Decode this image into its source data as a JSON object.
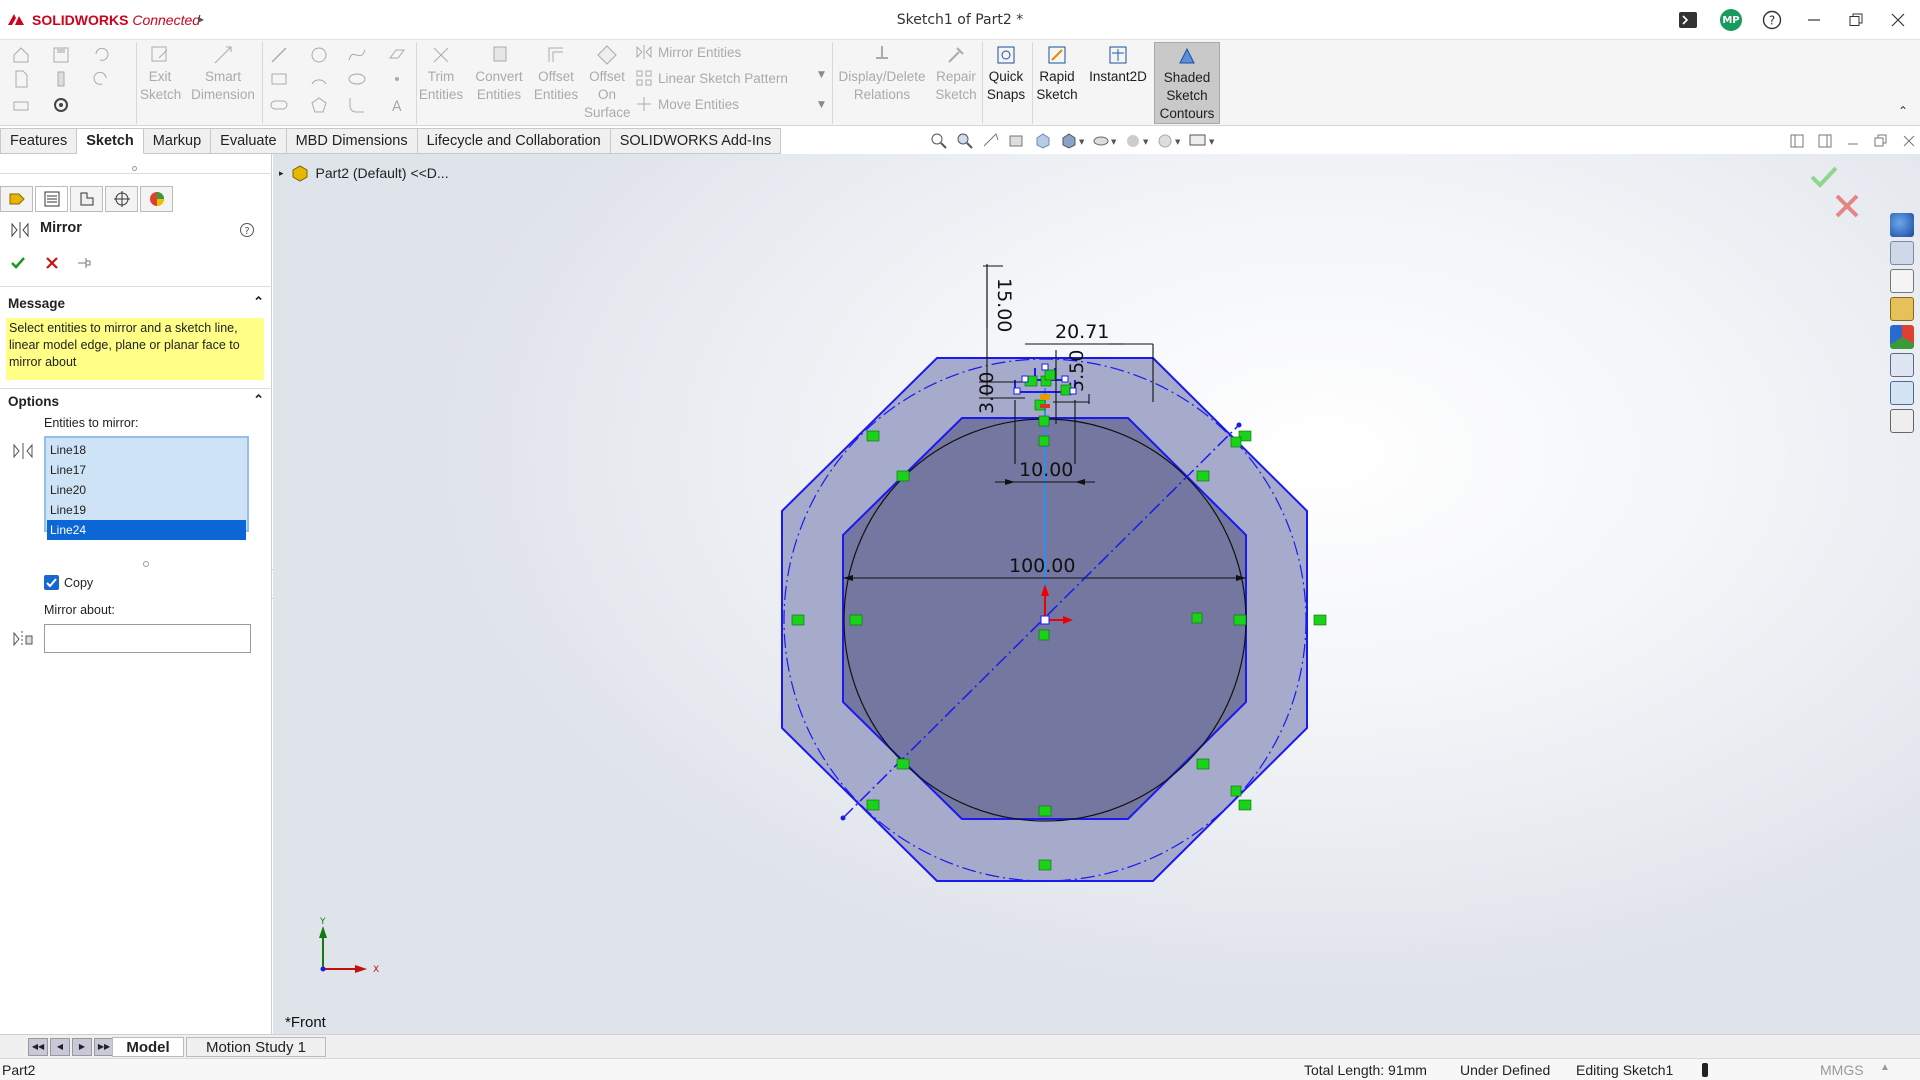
{
  "app": {
    "brand_bold": "SOLIDWORKS",
    "brand_rest": " Connected",
    "doc_title": "Sketch1 of Part2 *",
    "avatar": "MP"
  },
  "ribbon": {
    "exit_sketch": [
      "Exit",
      "Sketch"
    ],
    "smart_dimension": [
      "Smart",
      "Dimension"
    ],
    "trim_entities": [
      "Trim",
      "Entities"
    ],
    "convert_entities": [
      "Convert",
      "Entities"
    ],
    "offset_entities": [
      "Offset",
      "Entities"
    ],
    "offset_on_surface": [
      "Offset",
      "On",
      "Surface"
    ],
    "mirror_entities": "Mirror Entities",
    "linear_sketch_pattern": "Linear Sketch Pattern",
    "move_entities": "Move Entities",
    "display_delete_relations": [
      "Display/Delete",
      "Relations"
    ],
    "repair_sketch": [
      "Repair",
      "Sketch"
    ],
    "quick_snaps": [
      "Quick",
      "Snaps"
    ],
    "rapid_sketch": [
      "Rapid",
      "Sketch"
    ],
    "instant2d": "Instant2D",
    "shaded_sketch_contours": [
      "Shaded",
      "Sketch",
      "Contours"
    ]
  },
  "tabs": [
    "Features",
    "Sketch",
    "Markup",
    "Evaluate",
    "MBD Dimensions",
    "Lifecycle and Collaboration",
    "SOLIDWORKS Add-Ins"
  ],
  "property_manager": {
    "title": "Mirror",
    "message_header": "Message",
    "message": "Select entities to mirror and a sketch line, linear model edge, plane or planar face to mirror about",
    "options_header": "Options",
    "entities_label": "Entities to mirror:",
    "entities": [
      "Line18",
      "Line17",
      "Line20",
      "Line19",
      "Line24"
    ],
    "selected_entity": "Line24",
    "copy_label": "Copy",
    "copy_checked": true,
    "mirror_about_label": "Mirror about:",
    "mirror_about_value": ""
  },
  "viewport": {
    "tree_item": "Part2 (Default) <<D...",
    "view_name": "*Front",
    "dimensions": {
      "d1": "15.00",
      "d2": "20.71",
      "d3": "5.50",
      "d4": "3.00",
      "d5": "10.00",
      "d6": "100.00"
    },
    "triad": {
      "x": "X",
      "y": "Y"
    }
  },
  "bottom_tabs": [
    "Model",
    "Motion Study 1"
  ],
  "status": {
    "part": "Part2",
    "total_length": "Total Length: 91mm",
    "state": "Under Defined",
    "editing": "Editing Sketch1",
    "units": "MMGS"
  },
  "colors": {
    "sketch_blue": "#1a1aee",
    "fill": "#9aa0c6",
    "relation_green": "#19d219",
    "selection_blue": "#0b67d6",
    "message_yellow": "#ffff88"
  }
}
